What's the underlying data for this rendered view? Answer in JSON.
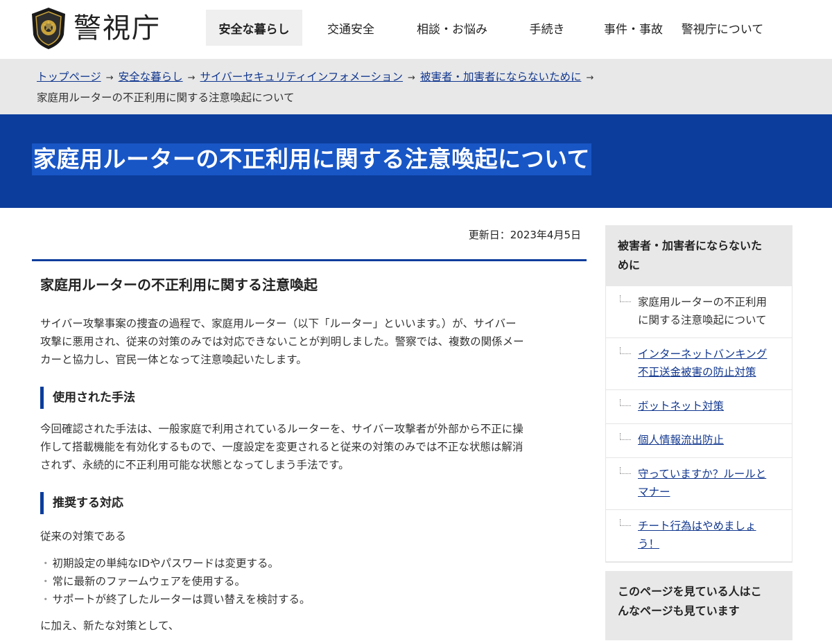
{
  "header": {
    "logo_text": "警視庁",
    "nav": [
      {
        "label": "安全な暮らし",
        "active": true
      },
      {
        "label": "交通安全",
        "active": false
      },
      {
        "label": "相談・お悩み",
        "active": false
      },
      {
        "label": "手続き",
        "active": false
      },
      {
        "label": "事件・事故",
        "active": false
      },
      {
        "label": "警視庁について",
        "active": false
      }
    ]
  },
  "breadcrumb": {
    "links": [
      "トップページ",
      "安全な暮らし",
      "サイバーセキュリティインフォメーション",
      "被害者・加害者にならないために"
    ],
    "current": "家庭用ルーターの不正利用に関する注意喚起について"
  },
  "page_title": "家庭用ルーターの不正利用に関する注意喚起について",
  "main": {
    "updated": "更新日：2023年4月5日",
    "heading": "家庭用ルーターの不正利用に関する注意喚起",
    "intro_lines": [
      "サイバー攻撃事案の捜査の過程で、家庭用ルーター（以下「ルーター」といいます。）が、サイバー",
      "攻撃に悪用され、従来の対策のみでは対応できないことが判明しました。警察では、複数の関係メー",
      "カーと協力し、官民一体となって注意喚起いたします。"
    ],
    "section1_title": "使用された手法",
    "section1_lines": [
      "今回確認された手法は、一般家庭で利用されているルーターを、サイバー攻撃者が外部から不正に操",
      "作して搭載機能を有効化するもので、一度設定を変更されると従来の対策のみでは不正な状態は解消",
      "されず、永続的に不正利用可能な状態となってしまう手法です。"
    ],
    "section2_title": "推奨する対応",
    "section2_lead": "従来の対策である",
    "bullets": [
      "初期設定の単純なIDやパスワードは変更する。",
      "常に最新のファームウェアを使用する。",
      "サポートが終了したルーターは買い替えを検討する。"
    ],
    "section2_tail": "に加え、新たな対策として、"
  },
  "sidebar": {
    "title_lines": [
      "被害者・加害者にならないた",
      "めに"
    ],
    "items": [
      {
        "lines": [
          "家庭用ルーターの不正利用",
          "に関する注意喚起について"
        ],
        "current": true
      },
      {
        "lines": [
          "インターネットバンキング",
          "不正送金被害の防止対策"
        ],
        "current": false
      },
      {
        "lines": [
          "ボットネット対策"
        ],
        "current": false
      },
      {
        "lines": [
          "個人情報流出防止"
        ],
        "current": false
      },
      {
        "lines": [
          "守っていますか？ルールと",
          "マナー"
        ],
        "current": false
      },
      {
        "lines": [
          "チート行為はやめましょ",
          "う！"
        ],
        "current": false
      }
    ],
    "related_title_lines": [
      "このページを見ている人はこ",
      "んなページも見ています"
    ]
  }
}
